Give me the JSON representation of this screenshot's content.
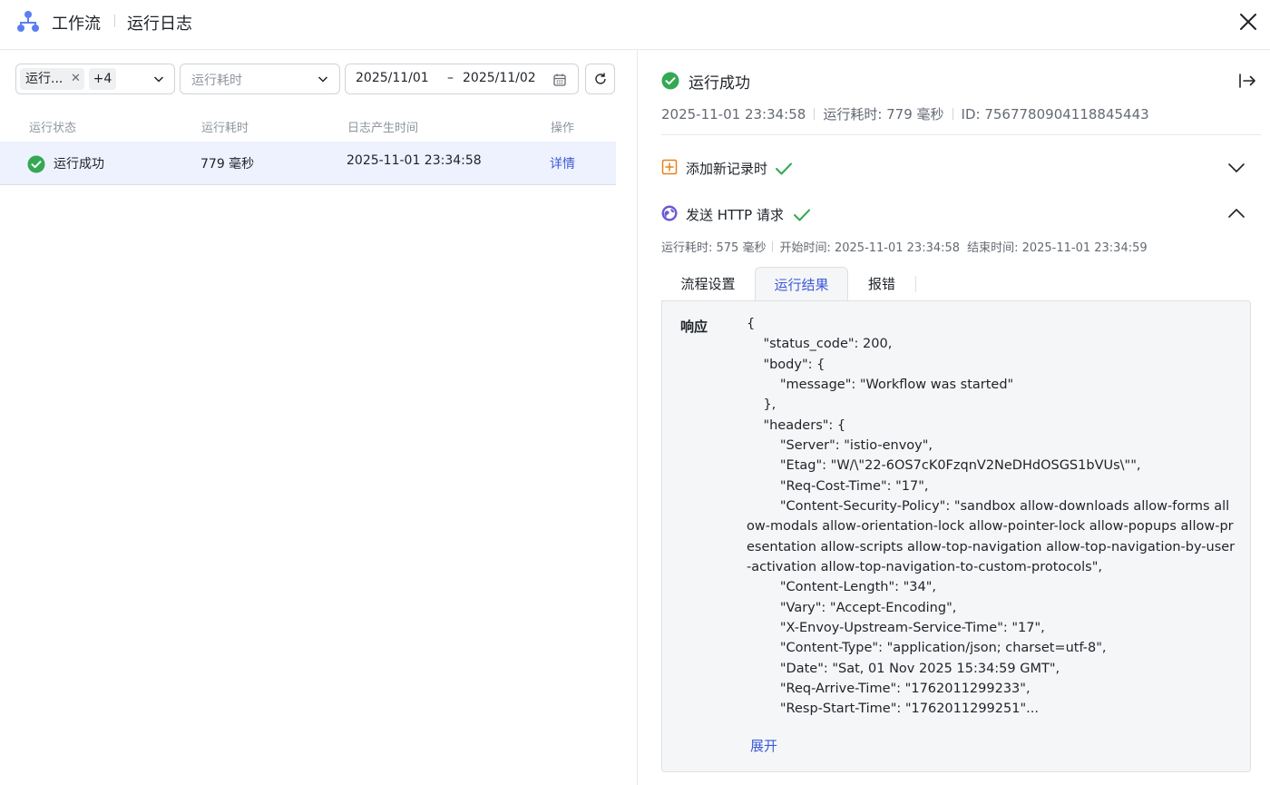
{
  "header": {
    "title": "工作流",
    "subtitle": "运行日志"
  },
  "filters": {
    "status_tag": "运行...",
    "status_more": "+4",
    "duration_placeholder": "运行耗时",
    "date_start": "2025/11/01",
    "date_sep": "–",
    "date_end": "2025/11/02"
  },
  "table": {
    "headers": [
      "运行状态",
      "运行耗时",
      "日志产生时间",
      "操作"
    ],
    "rows": [
      {
        "status": "运行成功",
        "duration": "779 毫秒",
        "time": "2025-11-01 23:34:58",
        "action": "详情"
      }
    ]
  },
  "detail": {
    "status": "运行成功",
    "time": "2025-11-01 23:34:58",
    "duration": "运行耗时: 779 毫秒",
    "id": "ID: 7567780904118845443",
    "nodes": [
      {
        "label": "添加新记录时"
      },
      {
        "label": "发送 HTTP 请求"
      }
    ],
    "node_meta": {
      "duration": "运行耗时: 575 毫秒",
      "start": "开始时间: 2025-11-01 23:34:58",
      "end": "结束时间: 2025-11-01 23:34:59"
    },
    "tabs": [
      "流程设置",
      "运行结果",
      "报错"
    ],
    "response_label": "响应",
    "code_lines": [
      "{",
      "    \"status_code\": 200,",
      "    \"body\": {",
      "        \"message\": \"Workflow was started\"",
      "    },",
      "    \"headers\": {",
      "        \"Server\": \"istio-envoy\",",
      "        \"Etag\": \"W/\\\"22-6OS7cK0FzqnV2NeDHdOSGS1bVUs\\\"\",",
      "        \"Req-Cost-Time\": \"17\",",
      "        \"Content-Security-Policy\": \"sandbox allow-downloads allow-forms allow-modals allow-orientation-lock allow-pointer-lock allow-popups allow-presentation allow-scripts allow-top-navigation allow-top-navigation-by-user-activation allow-top-navigation-to-custom-protocols\",",
      "        \"Content-Length\": \"34\",",
      "        \"Vary\": \"Accept-Encoding\",",
      "        \"X-Envoy-Upstream-Service-Time\": \"17\",",
      "        \"Content-Type\": \"application/json; charset=utf-8\",",
      "        \"Date\": \"Sat, 01 Nov 2025 15:34:59 GMT\",",
      "        \"Req-Arrive-Time\": \"1762011299233\",",
      "        \"Resp-Start-Time\": \"1762011299251\"..."
    ],
    "expand_label": "展开"
  },
  "colors": {
    "accent": "#3c5ad8",
    "success": "#34a853",
    "text": "#1f2329",
    "muted": "#646a73"
  }
}
